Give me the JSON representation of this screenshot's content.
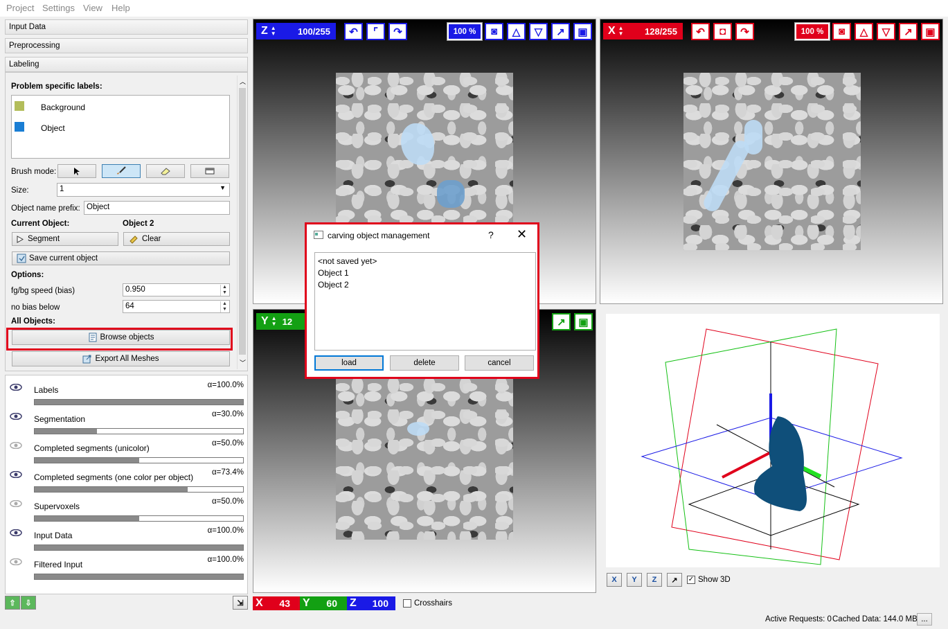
{
  "menu": [
    "Project",
    "Settings",
    "View",
    "Help"
  ],
  "drawers": {
    "input_data": "Input Data",
    "preprocessing": "Preprocessing",
    "labeling": "Labeling"
  },
  "labeling": {
    "problem_labels_title": "Problem specific labels:",
    "labels": [
      {
        "name": "Background",
        "color": "#b3bd5a"
      },
      {
        "name": "Object",
        "color": "#1a7ed4"
      }
    ],
    "brush_mode_label": "Brush mode:",
    "size_label": "Size:",
    "size_value": "1",
    "prefix_label": "Object name prefix:",
    "prefix_value": "Object",
    "current_object_label": "Current Object:",
    "current_object_value": "Object 2",
    "segment_label": "Segment",
    "clear_label": "Clear",
    "save_label": "Save current object",
    "options_label": "Options:",
    "bias_label": "fg/bg speed (bias)",
    "bias_value": "0.950",
    "nobias_label": "no bias below",
    "nobias_value": "64",
    "all_objects_label": "All Objects:",
    "browse_label": "Browse objects",
    "export_label": "Export All Meshes"
  },
  "layers": [
    {
      "name": "Labels",
      "alpha": "α=100.0%",
      "opacity": 1.0,
      "visible": true
    },
    {
      "name": "Segmentation",
      "alpha": "α=30.0%",
      "opacity": 0.3,
      "visible": true
    },
    {
      "name": "Completed segments (unicolor)",
      "alpha": "α=50.0%",
      "opacity": 0.5,
      "visible": false
    },
    {
      "name": "Completed segments (one color per object)",
      "alpha": "α=73.4%",
      "opacity": 0.734,
      "visible": true
    },
    {
      "name": "Supervoxels",
      "alpha": "α=50.0%",
      "opacity": 0.5,
      "visible": false
    },
    {
      "name": "Input Data",
      "alpha": "α=100.0%",
      "opacity": 1.0,
      "visible": true
    },
    {
      "name": "Filtered Input",
      "alpha": "α=100.0%",
      "opacity": 1.0,
      "visible": false
    }
  ],
  "viewers": {
    "z": {
      "axis": "Z",
      "slice": "100/255",
      "zoom": "100 %",
      "color": "#1a1ae6"
    },
    "x": {
      "axis": "X",
      "slice": "128/255",
      "zoom": "100 %",
      "color": "#e0001b"
    },
    "y": {
      "axis": "Y",
      "slice": "12",
      "color": "#13a013"
    }
  },
  "dialog": {
    "title": "carving object management",
    "help": "?",
    "items": [
      "<not saved yet>",
      "Object 1",
      "Object 2"
    ],
    "load": "load",
    "delete": "delete",
    "cancel": "cancel"
  },
  "coords": {
    "x_label": "X",
    "x": "43",
    "y_label": "Y",
    "y": "60",
    "z_label": "Z",
    "z": "100",
    "crosshairs": "Crosshairs"
  },
  "view3d": {
    "show3d": "Show 3D",
    "buttons": [
      "X",
      "Y",
      "Z"
    ]
  },
  "status": {
    "active_requests": "Active Requests: 0",
    "cached": "Cached Data: 144.0 MB",
    "more": "..."
  }
}
